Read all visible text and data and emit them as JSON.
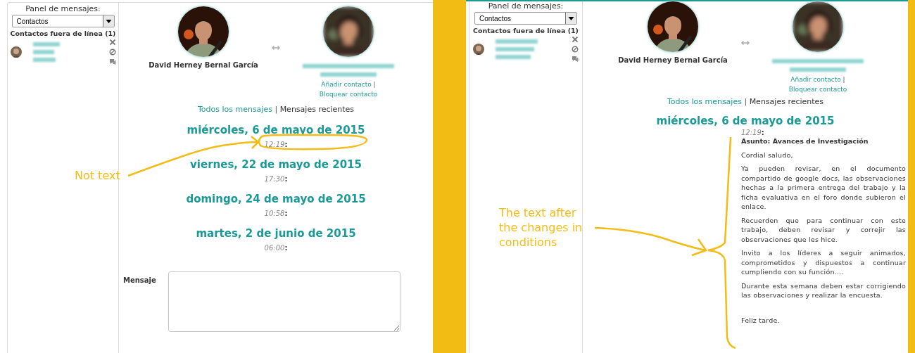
{
  "screens": [
    {
      "sidebar": {
        "label": "Panel de mensajes:",
        "select": {
          "value": "Contactos"
        },
        "heading": "Contactos fuera de línea (1)"
      },
      "me": {
        "name": "David Herney Bernal García"
      },
      "contact": {
        "links": [
          "Añadir contacto",
          "Bloquear contacto"
        ],
        "separator": "|"
      },
      "nav": {
        "items": [
          {
            "label": "Todos los mensajes",
            "selected": false
          },
          {
            "label": "Mensajes recientes",
            "selected": true
          }
        ],
        "separator": "|"
      },
      "days": [
        {
          "date": "miércoles, 6 de mayo de 2015",
          "time": "12:19",
          "mark": ":"
        },
        {
          "date": "viernes, 22 de mayo de 2015",
          "time": "17:30",
          "mark": ":"
        },
        {
          "date": "domingo, 24 de mayo de 2015",
          "time": "10:58",
          "mark": ":"
        },
        {
          "date": "martes, 2 de junio de 2015",
          "time": "06:00",
          "mark": ":"
        }
      ],
      "compose": {
        "label": "Mensaje"
      }
    },
    {
      "sidebar": {
        "label": "Panel de mensajes:",
        "select": {
          "value": "Contactos"
        },
        "heading": "Contactos fuera de línea (1)"
      },
      "me": {
        "name": "David Herney Bernal García"
      },
      "contact": {
        "links": [
          "Añadir contacto",
          "Bloquear contacto"
        ],
        "separator": "|"
      },
      "nav": {
        "items": [
          {
            "label": "Todos los mensajes",
            "selected": false
          },
          {
            "label": "Mensajes recientes",
            "selected": true
          }
        ],
        "separator": "|"
      },
      "days": [
        {
          "date": "miércoles, 6 de mayo de 2015",
          "time": "12:19",
          "mark": ":",
          "subject": "Asunto: Avances de Investigación",
          "paragraphs": [
            "Cordial saludo,",
            "Ya pueden revisar, en el documento compartido de google docs, las observaciones hechas a la primera entrega del trabajo y la ficha evaluativa en el foro donde subieron el enlace.",
            "Recuerden que para continuar con este trabajo, deben revisar y correjir las observaciones que les hice.",
            "Invito a los líderes a seguir animados, comprometidos y dispuestos a continuar cumpliendo con su función....",
            "Durante esta semana deben estar corrigiendo las observaciones y realizar la encuesta."
          ],
          "closing": "Feliz tarde."
        }
      ]
    }
  ],
  "annotations": [
    {
      "text": "Not text"
    },
    {
      "text": "The text after the changes in conditions"
    }
  ]
}
